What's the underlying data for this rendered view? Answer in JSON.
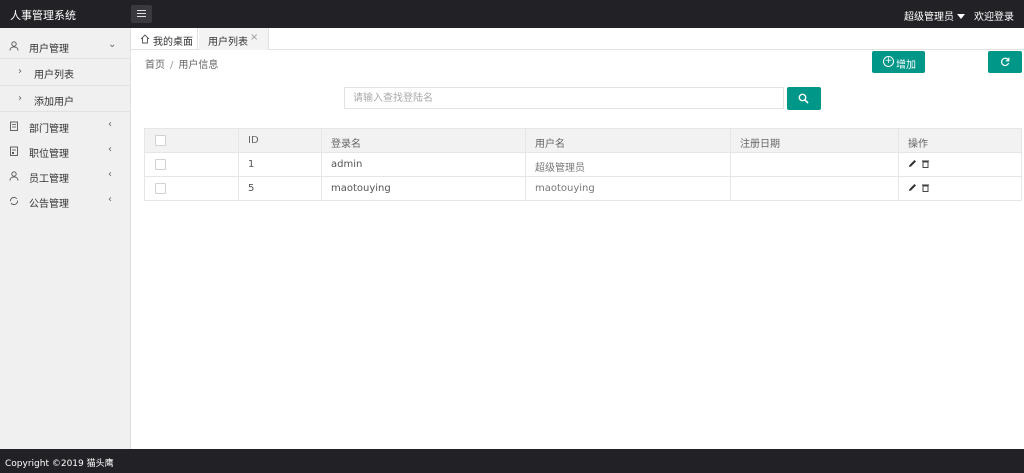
{
  "header": {
    "app_title": "人事管理系统",
    "user_menu_label": "超级管理员",
    "welcome_text": "欢迎登录"
  },
  "sidebar": {
    "items": [
      {
        "label": "用户管理",
        "icon": "user-icon",
        "expanded": true
      },
      {
        "label": "部门管理",
        "icon": "building-icon",
        "expanded": false
      },
      {
        "label": "职位管理",
        "icon": "briefcase-icon",
        "expanded": false
      },
      {
        "label": "员工管理",
        "icon": "users-icon",
        "expanded": false
      },
      {
        "label": "公告管理",
        "icon": "refresh-circle-icon",
        "expanded": false
      }
    ],
    "subitems": [
      {
        "label": "用户列表"
      },
      {
        "label": "添加用户"
      }
    ]
  },
  "tabs": [
    {
      "label": "我的桌面",
      "icon": "home-icon",
      "active": false
    },
    {
      "label": "用户列表",
      "active": true,
      "closable": true
    }
  ],
  "breadcrumb": {
    "home": "首页",
    "separator": "/",
    "current": "用户信息"
  },
  "toolbar": {
    "add_label": "增加",
    "refresh_icon": "refresh-icon"
  },
  "search": {
    "placeholder": "请输入查找登陆名",
    "value": ""
  },
  "table": {
    "columns": [
      "",
      "ID",
      "登录名",
      "用户名",
      "注册日期",
      "操作"
    ],
    "rows": [
      {
        "id": "1",
        "login": "admin",
        "username": "超级管理员",
        "date": ""
      },
      {
        "id": "5",
        "login": "maotouying",
        "username": "maotouying",
        "date": ""
      }
    ]
  },
  "footer": {
    "copyright": "Copyright ©2019 猫头鹰"
  },
  "colors": {
    "header_bg": "#222226",
    "accent": "#009688",
    "sidebar_bg": "#f0f0f0"
  }
}
